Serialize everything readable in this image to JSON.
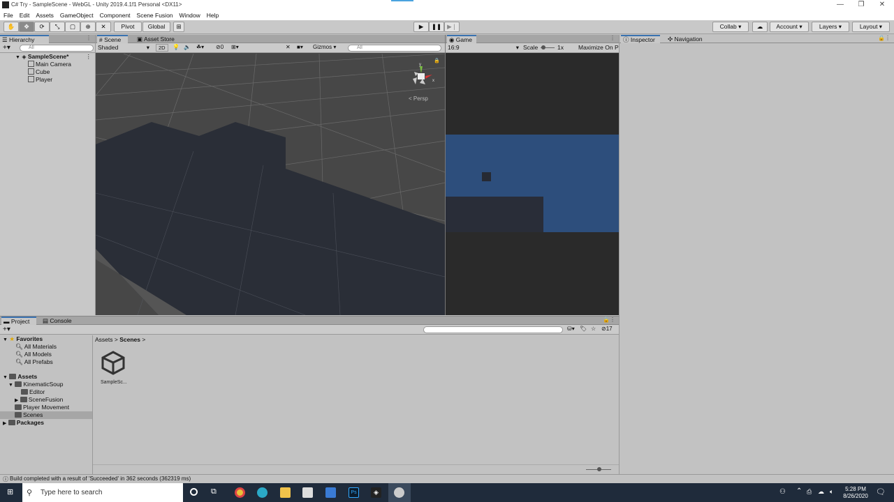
{
  "window": {
    "title": "C# Try - SampleScene - WebGL - Unity 2019.4.1f1 Personal <DX11>",
    "minimize": "—",
    "maximize": "❐",
    "close": "✕"
  },
  "menu": [
    "File",
    "Edit",
    "Assets",
    "GameObject",
    "Component",
    "Scene Fusion",
    "Window",
    "Help"
  ],
  "toolbar": {
    "pivot": "Pivot",
    "global": "Global",
    "collab": "Collab ▾",
    "account": "Account",
    "layers": "Layers",
    "layout": "Layout"
  },
  "hierarchy": {
    "tab": "Hierarchy",
    "search_placeholder": "All",
    "scene": "SampleScene*",
    "items": [
      "Main Camera",
      "Cube",
      "Player"
    ]
  },
  "scene_panel": {
    "tabs": [
      "Scene",
      "Asset Store"
    ],
    "shading": "Shaded",
    "mode_2d": "2D",
    "gizmos": "Gizmos",
    "search_placeholder": "All",
    "hidden_count": "0",
    "persp": "Persp"
  },
  "game_panel": {
    "tab": "Game",
    "aspect": "16:9",
    "scale_label": "Scale",
    "scale_value": "1x",
    "maximize": "Maximize On Pl"
  },
  "inspector": {
    "tabs": [
      "Inspector",
      "Navigation"
    ]
  },
  "project": {
    "tabs": [
      "Project",
      "Console"
    ],
    "favorites_label": "Favorites",
    "favorites": [
      "All Materials",
      "All Models",
      "All Prefabs"
    ],
    "assets_label": "Assets",
    "assets_tree": [
      "KinematicSoup",
      "Editor",
      "SceneFusion",
      "Player Movement",
      "Scenes"
    ],
    "packages_label": "Packages",
    "breadcrumb": [
      "Assets",
      "Scenes"
    ],
    "file_name": "SampleSc...",
    "count": "17"
  },
  "status": {
    "message": "Build completed with a result of 'Succeeded' in 362 seconds (362319 ms)"
  },
  "taskbar": {
    "search_placeholder": "Type here to search",
    "time": "5:28 PM",
    "date": "8/26/2020"
  },
  "colors": {
    "game_sky": "#2d4e7c",
    "game_dark": "#292d38",
    "scene_bg": "#464646",
    "accent": "#3a72b0"
  }
}
